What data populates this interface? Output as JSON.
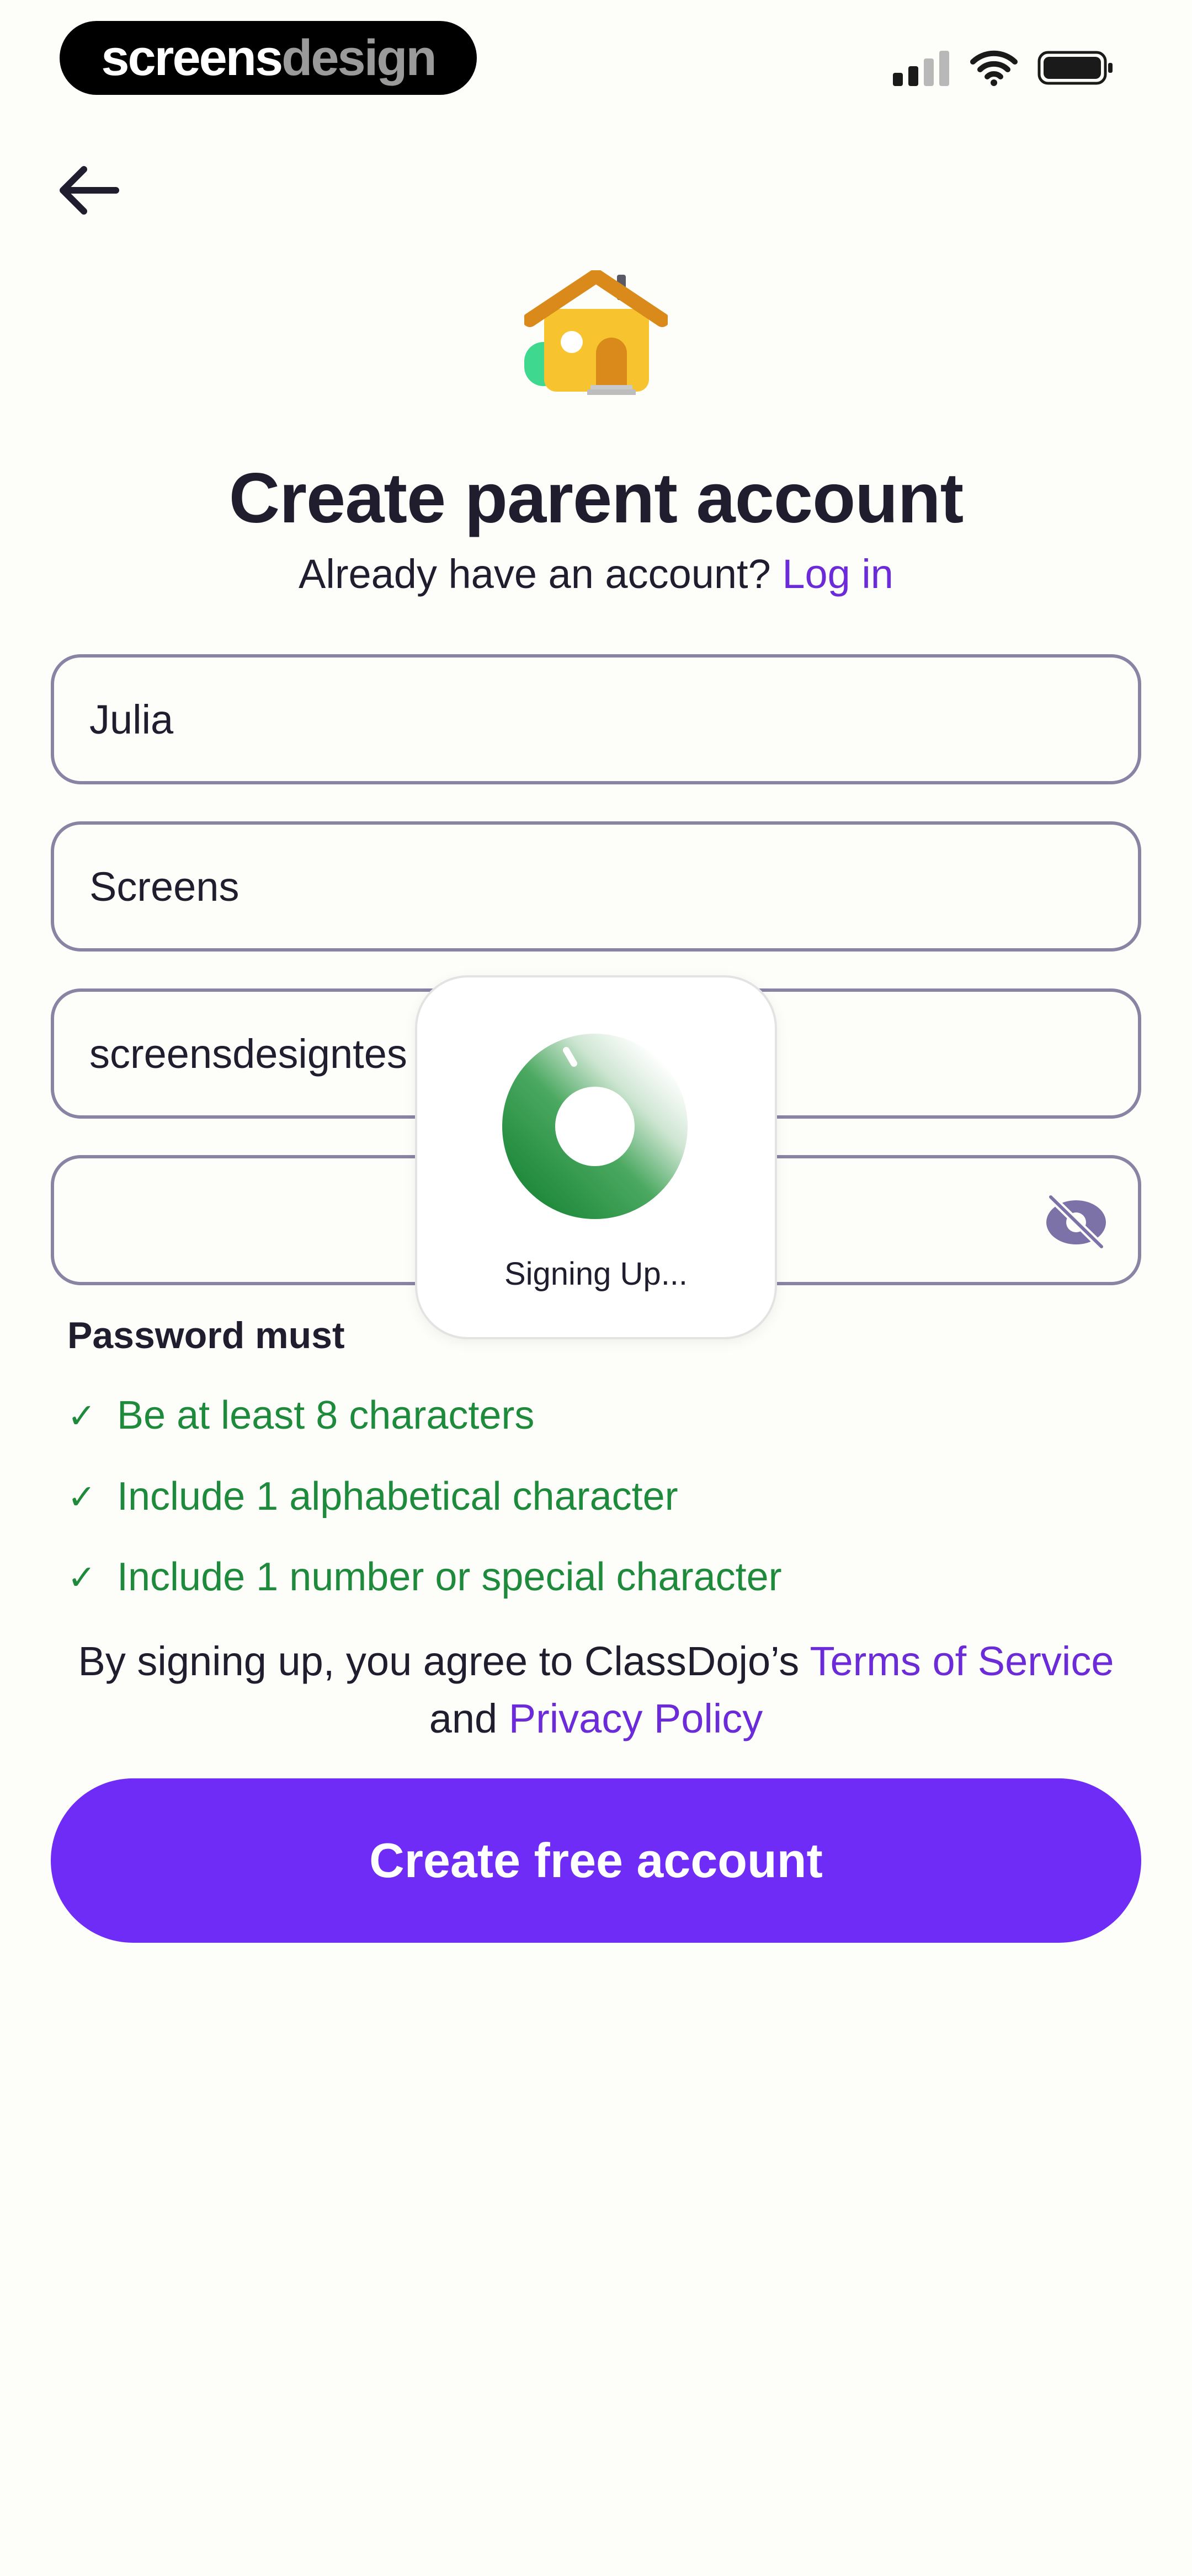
{
  "status_bar": {
    "brand_part1": "screens",
    "brand_part2": "design"
  },
  "header": {
    "title": "Create parent account",
    "subtitle_text": "Already have an account?",
    "login_link": "Log in"
  },
  "form": {
    "first_name": "Julia",
    "last_name": "Screens",
    "email": "screensdesigntes",
    "password": ""
  },
  "password_rules": {
    "title": "Password must",
    "items": [
      "Be at least 8 characters",
      "Include 1 alphabetical character",
      "Include 1 number or special character"
    ]
  },
  "terms": {
    "prefix": "By signing up, you agree to ClassDojo’s",
    "terms_link": "Terms of Service",
    "and": "and",
    "privacy_link": "Privacy Policy"
  },
  "cta": {
    "label": "Create free account"
  },
  "loader": {
    "label": "Signing Up..."
  },
  "colors": {
    "accent": "#6f2cf6",
    "link": "#6c2bd9",
    "success": "#1e8a3c",
    "field_border": "#8884a4"
  }
}
